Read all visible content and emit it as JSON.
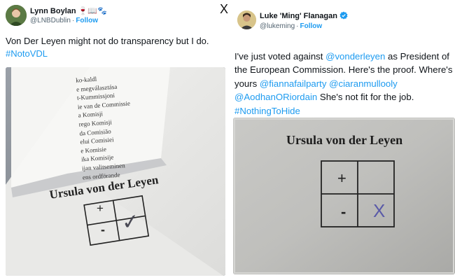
{
  "left_tweet": {
    "author_name": "Lynn Boylan",
    "name_emoji": "🍷📖🐾",
    "handle": "@LNBDublin",
    "separator": "·",
    "follow_label": "Follow",
    "text_line1": "Von Der Leyen might not do transparency but I do.",
    "hashtag": "#NotoVDL",
    "photo": {
      "paper_lines": [
        "Ursula von der Leyen"
      ],
      "back_sheet_lines": [
        "ko-kaldl",
        "e megválasztása",
        "t-Kummissjoni",
        "ie van de Commissie",
        "a Komisji",
        "rego Komisji",
        "da Comisião",
        "elui Comisiei",
        "e Komisie",
        "ika Komisije",
        "ijan valitseminen",
        "ens ordförande"
      ],
      "plus": "+",
      "minus": "-",
      "mark": "✓"
    }
  },
  "right_tweet": {
    "author_name": "Luke 'Ming' Flanagan",
    "handle": "@lukeming",
    "separator": "·",
    "follow_label": "Follow",
    "text_part1": "I've just voted against ",
    "mention_vdl": "@vonderleyen",
    "text_part2": " as President of the European Commission. Here's the proof. Where's yours ",
    "mention1": "@fiannafailparty",
    "mention2": "@ciaranmullooly",
    "mention3": "@AodhanORiordain",
    "text_part3": "She's not fit for the job. ",
    "hashtag": "#NothingToHide",
    "photo": {
      "paper_title": "Ursula von der Leyen",
      "plus": "+",
      "minus": "-",
      "mark": "X"
    }
  },
  "close_glyph": "X",
  "colors": {
    "link": "#1d9bf0",
    "text": "#0f1419",
    "muted": "#536471",
    "verified": "#1d9bf0"
  }
}
